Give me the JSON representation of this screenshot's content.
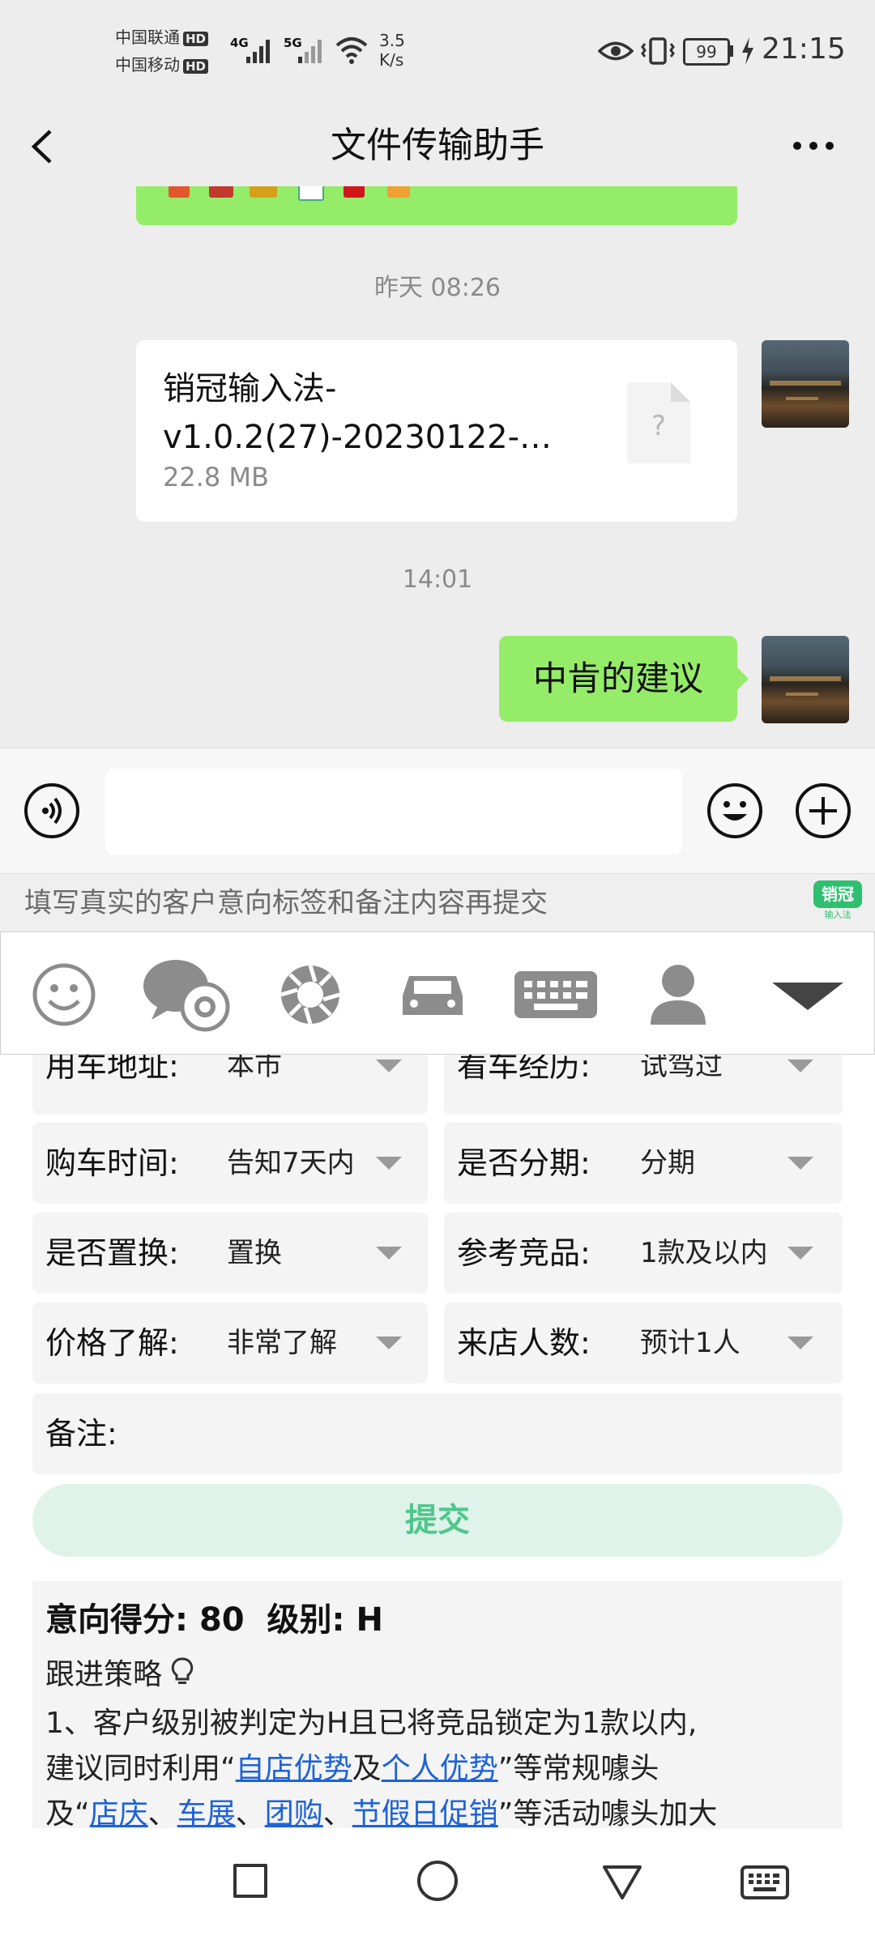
{
  "status_bar": {
    "carrier1": "中国联通",
    "carrier2": "中国移动",
    "hd": "HD",
    "net1": "4G",
    "net2": "5G",
    "speed_value": "3.5",
    "speed_unit": "K/s",
    "battery": "99",
    "time": "21:15"
  },
  "nav": {
    "title": "文件传输助手",
    "back_icon": "chevron-left-icon",
    "more_icon": "more-icon"
  },
  "chat": {
    "time1": "昨天 08:26",
    "file_name_line1": "销冠输入法-",
    "file_name_line2": "v1.0.2(27)-20230122-…",
    "file_size": "22.8 MB",
    "file_icon_glyph": "?",
    "time2": "14:01",
    "message": "中肯的建议",
    "bubble_color": "#95ec69"
  },
  "input_bar": {
    "voice_icon": "voice-icon",
    "emoji_icon": "emoji-icon",
    "plus_icon": "plus-icon"
  },
  "hint": {
    "text": "填写真实的客户意向标签和备注内容再提交",
    "logo_text1": "销冠",
    "logo_text2": "输入法"
  },
  "keyboard_toolbar": {
    "icons": [
      "smiley-icon",
      "chat-settings-icon",
      "shutter-icon",
      "car-icon",
      "keyboard-icon",
      "person-icon",
      "collapse-icon"
    ]
  },
  "form": {
    "rows": [
      {
        "l_label": "用车地址:",
        "l_value": "本市",
        "r_label": "看车经历:",
        "r_value": "试驾过"
      },
      {
        "l_label": "购车时间:",
        "l_value": "告知7天内",
        "r_label": "是否分期:",
        "r_value": "分期"
      },
      {
        "l_label": "是否置换:",
        "l_value": "置换",
        "r_label": "参考竞品:",
        "r_value": "1款及以内"
      },
      {
        "l_label": "价格了解:",
        "l_value": "非常了解",
        "r_label": "来店人数:",
        "r_value": "预计1人"
      }
    ],
    "note_label": "备注:",
    "submit_label": "提交",
    "submit_color": "#4fc78c"
  },
  "result": {
    "score_label": "意向得分:",
    "score": "80",
    "level_label": "级别:",
    "level": "H",
    "strategy_label": "跟进策略",
    "strategy_icon": "lightbulb-icon",
    "line1": "1、客户级别被判定为H且已将竞品锁定为1款以内,",
    "line2_pre": "建议同时利用“",
    "link1": "自店优势",
    "line2_mid": "及",
    "link2": "个人优势",
    "line2_post": "”等常规噱头",
    "line3_pre": "及“",
    "link3": "店庆",
    "sep1": "、",
    "link4": "车展",
    "sep2": "、",
    "link5": "团购",
    "sep3": "、",
    "link6": "节假日促销",
    "line3_post": "”等活动噱头加大"
  },
  "system_nav": {
    "icons": [
      "recent-apps-icon",
      "home-icon",
      "back-icon",
      "keyboard-switch-icon"
    ]
  }
}
